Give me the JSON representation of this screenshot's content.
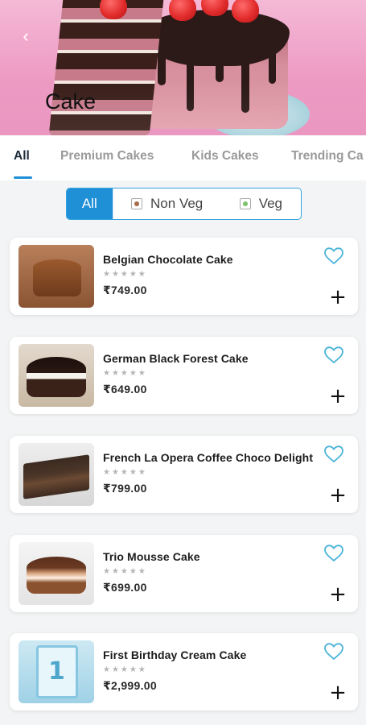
{
  "header": {
    "title": "Cake",
    "back_icon": "chevron-left-icon"
  },
  "tabs": [
    {
      "label": "All",
      "active": true
    },
    {
      "label": "Premium Cakes",
      "active": false
    },
    {
      "label": "Kids Cakes",
      "active": false
    },
    {
      "label": "Trending Ca",
      "active": false
    }
  ],
  "filter": {
    "all": "All",
    "non_veg": "Non Veg",
    "veg": "Veg",
    "active": "All"
  },
  "products": [
    {
      "name": "Belgian Chocolate Cake",
      "price": "₹749.00",
      "rating": 0,
      "favorited": false
    },
    {
      "name": "German Black Forest Cake",
      "price": "₹649.00",
      "rating": 0,
      "favorited": false
    },
    {
      "name": "French La Opera Coffee Choco Delight",
      "price": "₹799.00",
      "rating": 0,
      "favorited": false
    },
    {
      "name": "Trio Mousse Cake",
      "price": "₹699.00",
      "rating": 0,
      "favorited": false
    },
    {
      "name": "First Birthday Cream Cake",
      "price": "₹2,999.00",
      "rating": 0,
      "favorited": false
    }
  ],
  "colors": {
    "accent": "#1f8fd6",
    "heart": "#4ab3d8",
    "banner": "#ee9cc4"
  }
}
